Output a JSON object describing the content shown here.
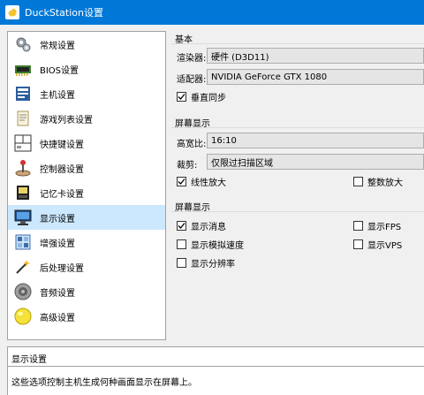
{
  "window": {
    "title": "DuckStation设置"
  },
  "sidebar": {
    "items": [
      {
        "label": "常规设置",
        "icon": "general-settings-icon",
        "selected": false
      },
      {
        "label": "BIOS设置",
        "icon": "bios-chip-icon",
        "selected": false
      },
      {
        "label": "主机设置",
        "icon": "console-icon",
        "selected": false
      },
      {
        "label": "游戏列表设置",
        "icon": "game-list-icon",
        "selected": false
      },
      {
        "label": "快捷键设置",
        "icon": "keyboard-icon",
        "selected": false
      },
      {
        "label": "控制器设置",
        "icon": "joystick-icon",
        "selected": false
      },
      {
        "label": "记忆卡设置",
        "icon": "memory-card-icon",
        "selected": false
      },
      {
        "label": "显示设置",
        "icon": "monitor-icon",
        "selected": true
      },
      {
        "label": "增强设置",
        "icon": "enhancement-icon",
        "selected": false
      },
      {
        "label": "后处理设置",
        "icon": "post-processing-icon",
        "selected": false
      },
      {
        "label": "音频设置",
        "icon": "speaker-icon",
        "selected": false
      },
      {
        "label": "高级设置",
        "icon": "advanced-settings-icon",
        "selected": false
      }
    ]
  },
  "basic": {
    "title": "基本",
    "renderer_label": "渲染器:",
    "renderer_value": "硬件 (D3D11)",
    "adapter_label": "适配器:",
    "adapter_value": "NVIDIA GeForce GTX 1080",
    "vsync_label": "垂直同步",
    "vsync_checked": true
  },
  "screen": {
    "title": "屏幕显示",
    "aspect_label": "高宽比:",
    "aspect_value": "16:10",
    "crop_label": "裁剪:",
    "crop_value": "仅限过扫描区域",
    "linear_label": "线性放大",
    "linear_checked": true,
    "integer_label": "整数放大",
    "integer_checked": false
  },
  "osd": {
    "title": "屏幕显示",
    "show_messages_label": "显示消息",
    "show_messages_checked": true,
    "show_fps_label": "显示FPS",
    "show_fps_checked": false,
    "show_speed_label": "显示模拟速度",
    "show_speed_checked": false,
    "show_vps_label": "显示VPS",
    "show_vps_checked": false,
    "show_resolution_label": "显示分辨率",
    "show_resolution_checked": false
  },
  "description": {
    "title": "显示设置",
    "text": "这些选项控制主机生成何种画面显示在屏幕上。"
  },
  "colors": {
    "titlebar": "#0078d7",
    "selection": "#cce8ff"
  }
}
